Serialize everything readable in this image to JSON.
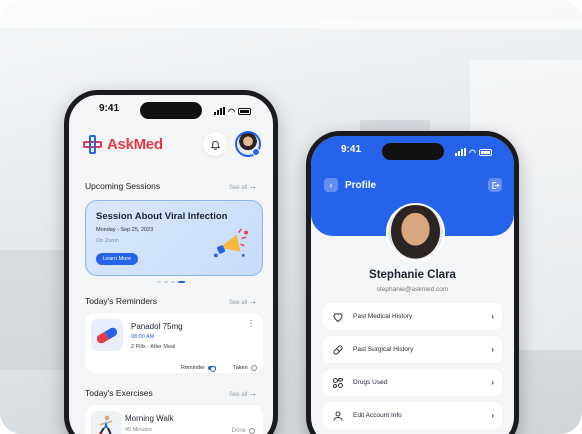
{
  "status_time": "9:41",
  "left": {
    "brand": "AskMed",
    "sections": {
      "sessions_title": "Upcoming Sessions",
      "reminders_title": "Today's Reminders",
      "exercises_title": "Today's Exercises",
      "see_all": "See all"
    },
    "session": {
      "title": "Session About Viral Infection",
      "date": "Monday - Sep 25, 2023",
      "location": "On Zoom",
      "button": "Learn More"
    },
    "reminder": {
      "name": "Panadol 75mg",
      "time": "08:00 AM",
      "dose": "2 Pills - After Meal",
      "reminder_label": "Reminder",
      "taken_label": "Taken"
    },
    "exercise": {
      "name": "Morning Walk",
      "duration": "45 Minutes",
      "done_label": "Done"
    }
  },
  "right": {
    "title": "Profile",
    "name": "Stephanie Clara",
    "email": "stephanie@askmed.com",
    "menu": [
      {
        "label": "Past Medical History",
        "icon": "heart-icon"
      },
      {
        "label": "Past Surgical History",
        "icon": "bandage-icon"
      },
      {
        "label": "Drugs Used",
        "icon": "pills-icon"
      },
      {
        "label": "Edit Account Info",
        "icon": "user-icon"
      }
    ]
  },
  "colors": {
    "primary": "#2563eb",
    "brand_red": "#e63946"
  }
}
